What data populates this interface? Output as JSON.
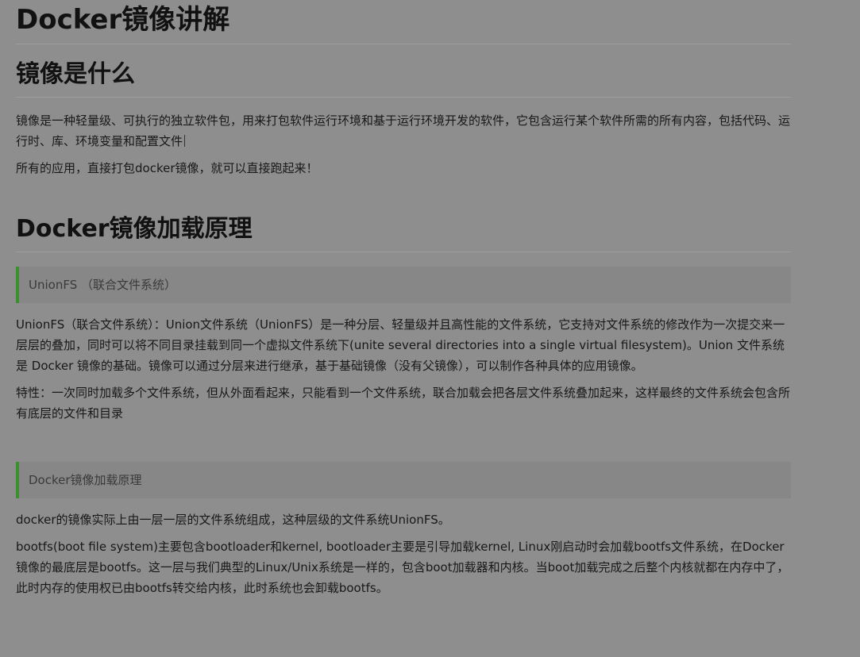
{
  "title": "Docker镜像讲解",
  "section1": {
    "heading": "镜像是什么",
    "paragraphs": [
      "镜像是一种轻量级、可执行的独立软件包，用来打包软件运行环境和基于运行环境开发的软件，它包含运行某个软件所需的所有内容，包括代码、运行时、库、环境变量和配置文件",
      "所有的应用，直接打包docker镜像，就可以直接跑起来！"
    ]
  },
  "section2": {
    "heading": "Docker镜像加载原理",
    "quote1": "UnionFS （联合文件系统）",
    "unionfs_paragraphs": [
      "UnionFS（联合文件系统）：Union文件系统（UnionFS）是一种分层、轻量级并且高性能的文件系统，它支持对文件系统的修改作为一次提交来一层层的叠加，同时可以将不同目录挂载到同一个虚拟文件系统下(unite several directories into a single virtual filesystem)。Union 文件系统是 Docker 镜像的基础。镜像可以通过分层来进行继承，基于基础镜像（没有父镜像），可以制作各种具体的应用镜像。",
      "特性：一次同时加载多个文件系统，但从外面看起来，只能看到一个文件系统，联合加载会把各层文件系统叠加起来，这样最终的文件系统会包含所有底层的文件和目录"
    ],
    "quote2": "Docker镜像加载原理",
    "loading_paragraphs": [
      "docker的镜像实际上由一层一层的文件系统组成，这种层级的文件系统UnionFS。",
      "bootfs(boot file system)主要包含bootloader和kernel, bootloader主要是引导加载kernel, Linux刚启动时会加载bootfs文件系统，在Docker镜像的最底层是bootfs。这一层与我们典型的Linux/Unix系统是一样的，包含boot加载器和内核。当boot加载完成之后整个内核就都在内存中了，此时内存的使用权已由bootfs转交给内核，此时系统也会卸载bootfs。"
    ]
  }
}
